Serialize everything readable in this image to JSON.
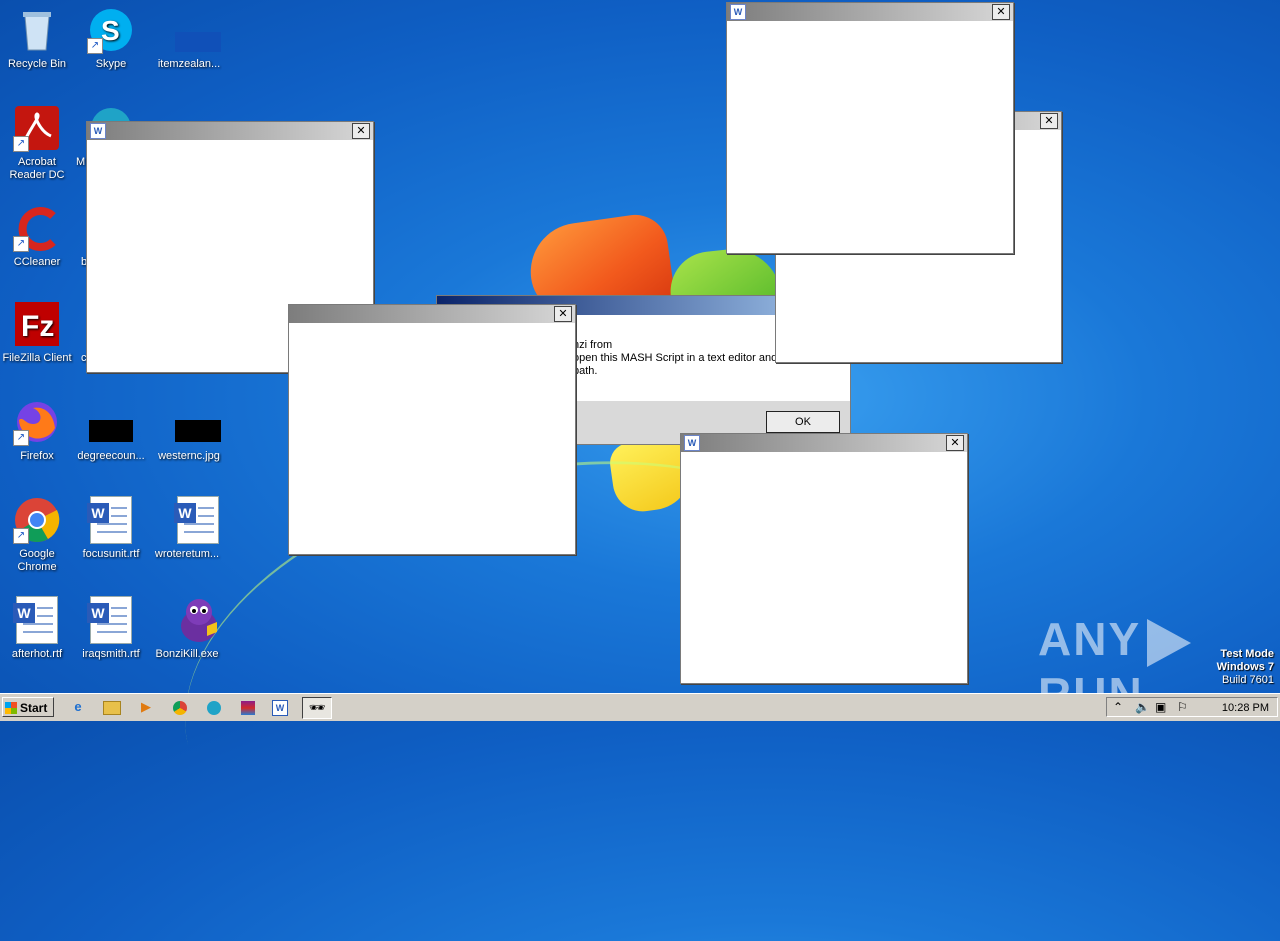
{
  "desktop": {
    "icons": [
      {
        "label": "Recycle Bin"
      },
      {
        "label": "Skype"
      },
      {
        "label": "itemzealan..."
      },
      {
        "label": "Acrobat Reader DC"
      },
      {
        "label": "M"
      },
      {
        "label": "CCleaner"
      },
      {
        "label": "b"
      },
      {
        "label": "FileZilla Client"
      },
      {
        "label": "c"
      },
      {
        "label": "Firefox"
      },
      {
        "label": "degreecoun..."
      },
      {
        "label": "westernc.jpg"
      },
      {
        "label": "Google Chrome"
      },
      {
        "label": "focusunit.rtf"
      },
      {
        "label": "wroteretum..."
      },
      {
        "label": "afterhot.rtf"
      },
      {
        "label": "iraqsmith.rtf"
      },
      {
        "label": "BonziKill.exe"
      }
    ]
  },
  "dialog": {
    "text_line1": "nzi from",
    "text_line2": "open this MASH Script in a text editor and",
    "text_line3": "path.",
    "ok_label": "OK"
  },
  "watermark": {
    "brand_left": "ANY",
    "brand_right": "RUN",
    "test_mode": "Test Mode",
    "os": "Windows 7",
    "build": "Build 7601"
  },
  "taskbar": {
    "start_label": "Start",
    "clock": "10:28 PM"
  }
}
